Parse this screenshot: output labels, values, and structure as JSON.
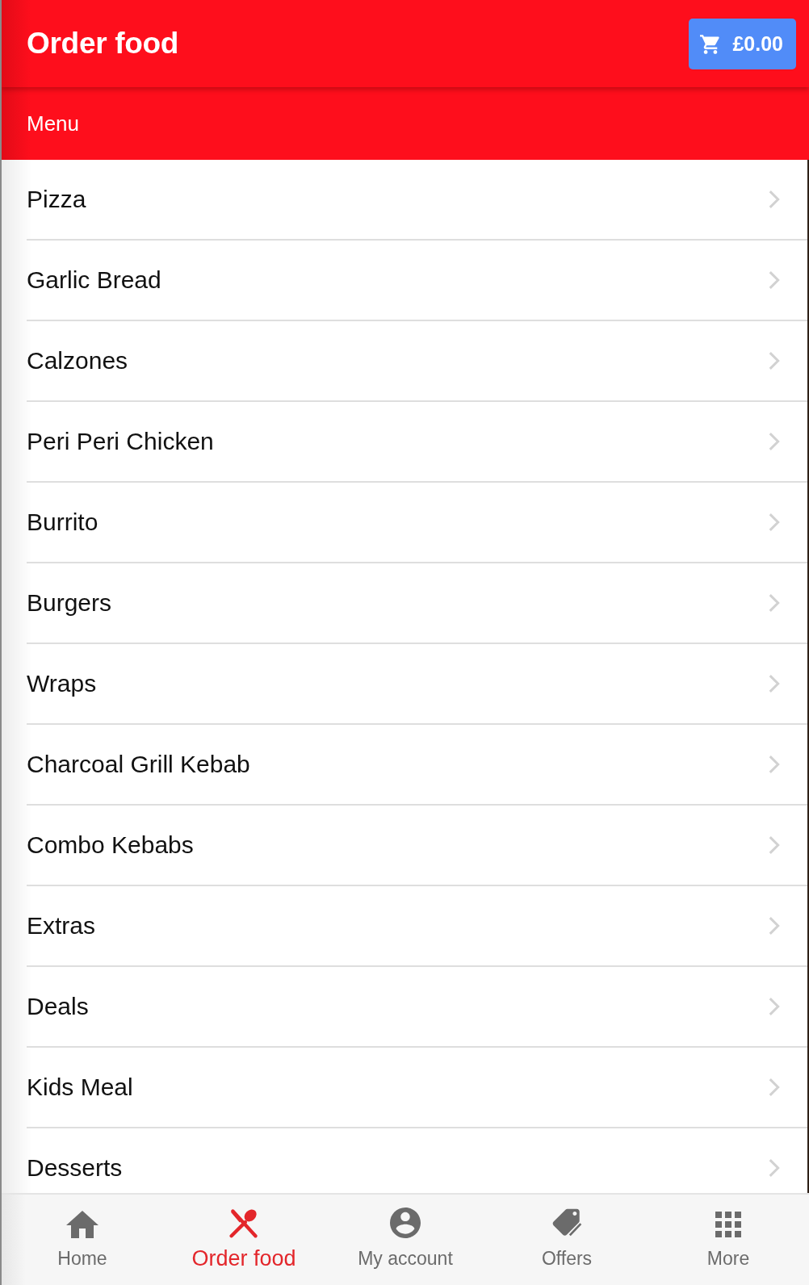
{
  "header": {
    "title": "Order food",
    "cart": {
      "total": "£0.00"
    }
  },
  "menu_bar": {
    "label": "Menu"
  },
  "categories": [
    {
      "name": "Pizza"
    },
    {
      "name": "Garlic Bread"
    },
    {
      "name": "Calzones"
    },
    {
      "name": "Peri Peri Chicken"
    },
    {
      "name": "Burrito"
    },
    {
      "name": "Burgers"
    },
    {
      "name": "Wraps"
    },
    {
      "name": "Charcoal Grill Kebab"
    },
    {
      "name": "Combo Kebabs"
    },
    {
      "name": "Extras"
    },
    {
      "name": "Deals"
    },
    {
      "name": "Kids Meal"
    },
    {
      "name": "Desserts"
    }
  ],
  "bottom_nav": [
    {
      "label": "Home",
      "kind": "home",
      "selected": false
    },
    {
      "label": "Order food",
      "kind": "cutlery",
      "selected": true
    },
    {
      "label": "My account",
      "kind": "account",
      "selected": false
    },
    {
      "label": "Offers",
      "kind": "tags",
      "selected": false
    },
    {
      "label": "More",
      "kind": "grid",
      "selected": false
    }
  ]
}
